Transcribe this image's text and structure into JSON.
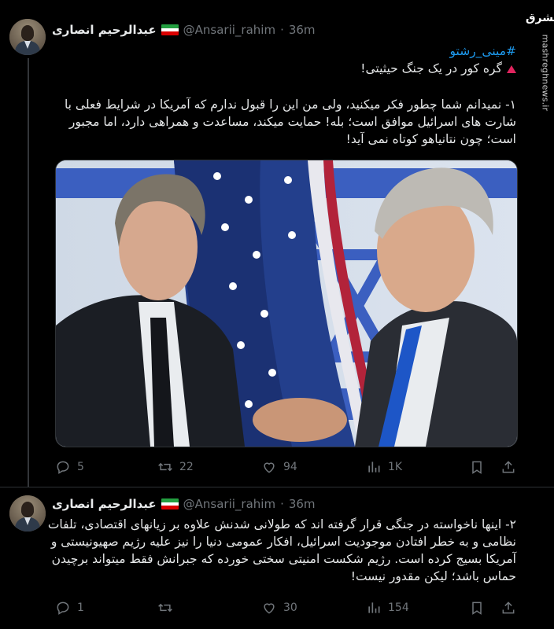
{
  "watermark": {
    "logo_text": "مشرق",
    "site": "mashreghnews.ir"
  },
  "tweets": [
    {
      "author_name": "عبدالرحیم انصاری",
      "handle": "@Ansarii_rahim",
      "separator": "·",
      "time": "36m",
      "hashtag": "#مینی_رشتو",
      "line1": "گره کور در یک جنگ حیثیتی!",
      "body": "۱- نمیدانم شما چطور فکر میکنید، ولی من این را قبول ندارم که آمریکا در شرایط فعلی با شارت های اسرائیل موافق است؛ بله! حمایت میکند، مساعدت و همراهی دارد، اما مجبور است؛ چون نتانیاهو کوتاه نمی آید!",
      "stats": {
        "replies": "5",
        "retweets": "22",
        "likes": "94",
        "views": "1K"
      }
    },
    {
      "author_name": "عبدالرحیم انصاری",
      "handle": "@Ansarii_rahim",
      "separator": "·",
      "time": "36m",
      "body": "۲- اینها ناخواسته در جنگی قرار گرفته اند که طولانی شدنش علاوه بر زیانهای اقتصادی، تلفات نظامی و به خطر افتادن موجودیت اسرائیل، افکار عمومی دنیا را نیز علیه رژیم صهیونیستی و آمریکا بسیج کرده است. رژیم شکست امنیتی سختی خورده که جبرانش فقط میتواند برچیدن حماس باشد؛ لیکن مقدور نیست!",
      "stats": {
        "replies": "1",
        "retweets": "",
        "likes": "30",
        "views": "154"
      }
    }
  ],
  "colors": {
    "background": "#000000",
    "text": "#e7e9ea",
    "muted": "#71767b",
    "link": "#1d9bf0",
    "divider": "#2f3336"
  }
}
